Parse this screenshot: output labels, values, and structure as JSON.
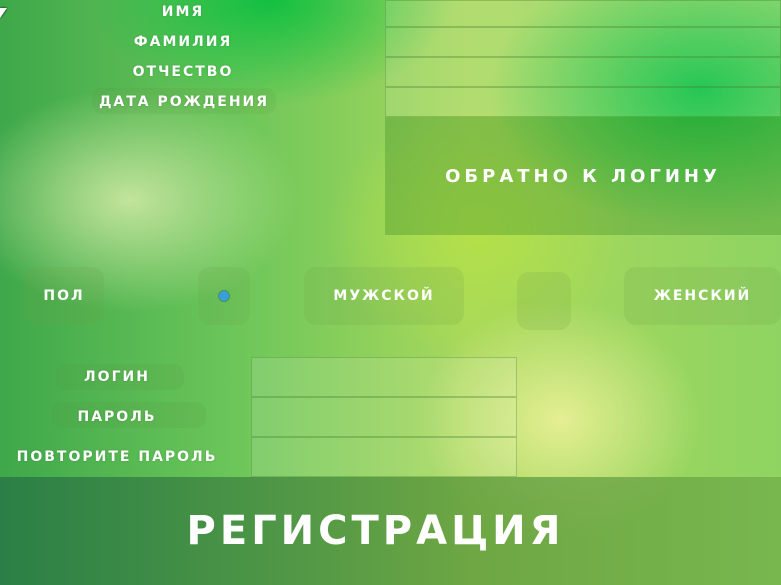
{
  "personal": {
    "first_name_label": "ИМЯ",
    "last_name_label": "ФАМИЛИЯ",
    "patronymic_label": "ОТЧЕСТВО",
    "birthdate_label": "ДАТА РОЖДЕНИЯ"
  },
  "back_button_label": "ОБРАТНО К ЛОГИНУ",
  "gender": {
    "label": "ПОЛ",
    "male_label": "МУЖСКОЙ",
    "female_label": "ЖЕНСКИЙ"
  },
  "account": {
    "login_label": "ЛОГИН",
    "password_label": "ПАРОЛЬ",
    "repeat_password_label": "ПОВТОРИТЕ ПАРОЛЬ"
  },
  "register_button_label": "РЕГИСТРАЦИЯ",
  "colors": {
    "radio_selected": "#3b9fd6",
    "accent_green": "#00c040"
  }
}
